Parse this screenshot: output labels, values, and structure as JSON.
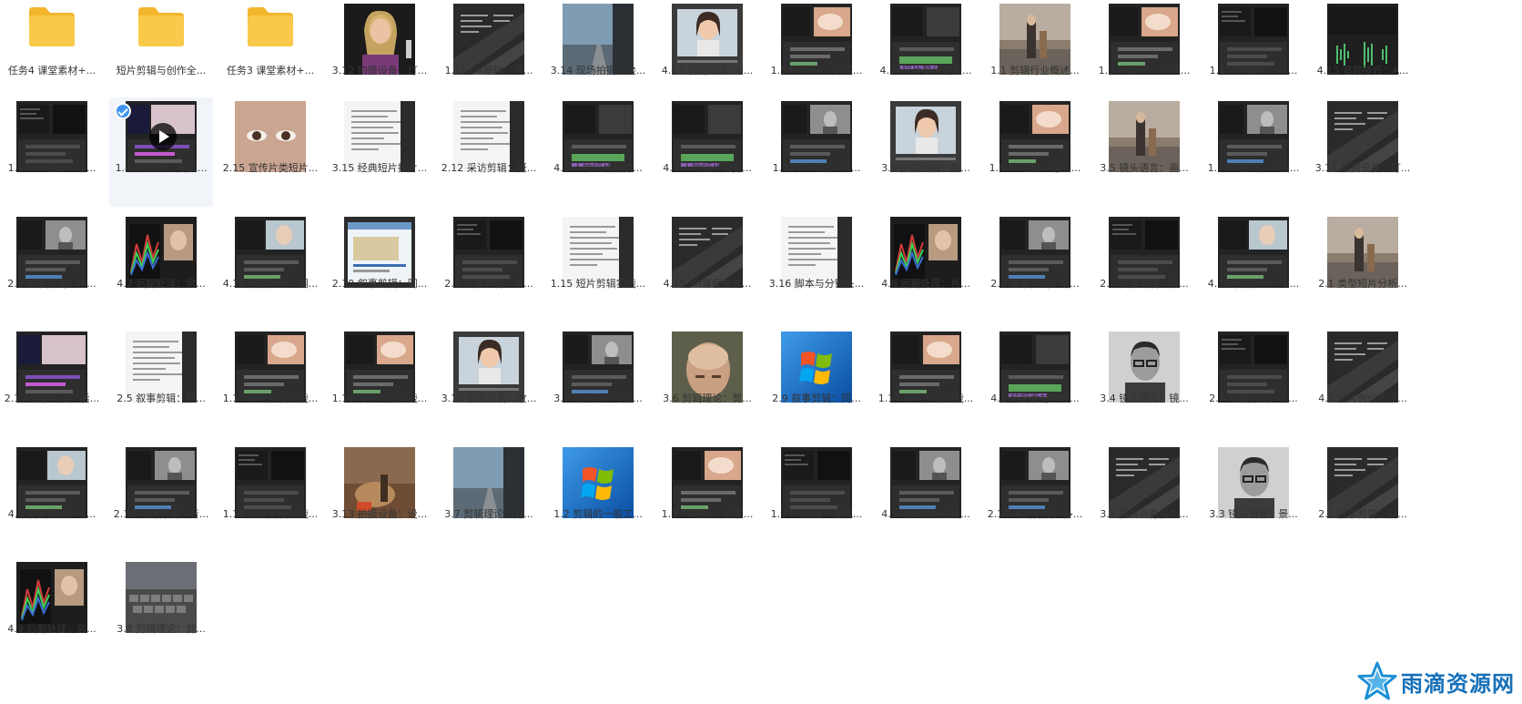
{
  "files": [
    {
      "label": "任务4 课堂素材+...",
      "kind": "folder"
    },
    {
      "label": "短片剪辑与创作全...",
      "kind": "folder"
    },
    {
      "label": "任务3 课堂素材+...",
      "kind": "folder"
    },
    {
      "label": "3.12 拍摄设备：灯...",
      "kind": "video",
      "style": "portrait"
    },
    {
      "label": "1.11 PR基础：常...",
      "kind": "video",
      "style": "dark-text"
    },
    {
      "label": "3.14 现场拍摄经验...",
      "kind": "video",
      "style": "road"
    },
    {
      "label": "4.11 后期处理：u...",
      "kind": "video",
      "style": "face-light"
    },
    {
      "label": "1.5 PR基础：剪辑...",
      "kind": "video",
      "style": "editor-warm"
    },
    {
      "label": "4.14短片整体调整...",
      "kind": "video",
      "style": "editor-green"
    },
    {
      "label": "1.1 剪辑行业概述...",
      "kind": "video",
      "style": "street"
    },
    {
      "label": "1.3 PR基础：新建...",
      "kind": "video",
      "style": "editor-warm"
    },
    {
      "label": "1.10 PR基础：遮...",
      "kind": "video",
      "style": "editor"
    },
    {
      "label": "4.13 音频技巧：A...",
      "kind": "video",
      "style": "audio"
    },
    {
      "label": "1.13 PR基础：输...",
      "kind": "video",
      "style": "editor"
    },
    {
      "label": "1.4 PR基础：窗口...",
      "kind": "video",
      "style": "editor-purple",
      "selected": true
    },
    {
      "label": "2.15 宣传片类短片...",
      "kind": "video",
      "style": "eye"
    },
    {
      "label": "3.15 经典短片拉片...",
      "kind": "video",
      "style": "doc"
    },
    {
      "label": "2.12 采访剪辑：概...",
      "kind": "video",
      "style": "doc"
    },
    {
      "label": "4.5 人物短片精剪...",
      "kind": "video",
      "style": "editor-green"
    },
    {
      "label": "4.4 人物短片粗剪...",
      "kind": "video",
      "style": "editor-green"
    },
    {
      "label": "1.12 PR基础：常...",
      "kind": "video",
      "style": "editor-gray"
    },
    {
      "label": "3.9 拍摄设备：拍...",
      "kind": "video",
      "style": "face-light"
    },
    {
      "label": "1.6 PR基础：标签...",
      "kind": "video",
      "style": "editor-warm"
    },
    {
      "label": "3.5 镜头语言：画...",
      "kind": "video",
      "style": "street"
    },
    {
      "label": "1.9 PR基础：动画...",
      "kind": "video",
      "style": "editor-gray"
    },
    {
      "label": "3.11 拍摄设备：灯...",
      "kind": "video",
      "style": "dark-text"
    },
    {
      "label": "2.3 叙事剪辑：读...",
      "kind": "video",
      "style": "editor-gray"
    },
    {
      "label": "4.7 后期处理：常...",
      "kind": "video",
      "style": "scopes"
    },
    {
      "label": "4.12 后期处理：调...",
      "kind": "video",
      "style": "editor-light"
    },
    {
      "label": "2.10 叙事剪辑：同...",
      "kind": "video",
      "style": "doc-blue"
    },
    {
      "label": "2.8 叙事剪辑：快...",
      "kind": "video",
      "style": "editor"
    },
    {
      "label": "1.15 短片剪辑实战...",
      "kind": "video",
      "style": "doc"
    },
    {
      "label": "4.15 PR课程整体...",
      "kind": "video",
      "style": "dark-text"
    },
    {
      "label": "3.16 脚本与分镜头...",
      "kind": "video",
      "style": "doc"
    },
    {
      "label": "4.6 后期处理：色...",
      "kind": "video",
      "style": "scopes"
    },
    {
      "label": "2.6 叙事剪辑：精...",
      "kind": "video",
      "style": "editor-gray"
    },
    {
      "label": "2.4 叙事剪辑：素...",
      "kind": "video",
      "style": "editor"
    },
    {
      "label": "4.10 后期处理：u...",
      "kind": "video",
      "style": "editor-light"
    },
    {
      "label": "2.1 类型短片分析...",
      "kind": "video",
      "style": "street"
    },
    {
      "label": "2.11 叙事剪辑：后...",
      "kind": "video",
      "style": "editor-purple"
    },
    {
      "label": "2.5 叙事剪辑：粗...",
      "kind": "video",
      "style": "doc"
    },
    {
      "label": "1.17 短片剪辑实战...",
      "kind": "video",
      "style": "editor-warm"
    },
    {
      "label": "1.16 短片剪辑实战...",
      "kind": "video",
      "style": "editor-warm"
    },
    {
      "label": "3.10 拍摄设备：收...",
      "kind": "video",
      "style": "face-light"
    },
    {
      "label": "3.2 短片分析与推...",
      "kind": "video",
      "style": "editor-gray"
    },
    {
      "label": "3.6 剪辑理论：剪...",
      "kind": "video",
      "style": "face-dark"
    },
    {
      "label": "2.9 叙事剪辑：同...",
      "kind": "video",
      "style": "windows"
    },
    {
      "label": "1.14 短片剪辑实战...",
      "kind": "video",
      "style": "editor-warm"
    },
    {
      "label": "4.2 前期素材整理...",
      "kind": "video",
      "style": "editor-green"
    },
    {
      "label": "3.4 镜头语言：镜...",
      "kind": "video",
      "style": "face-gray"
    },
    {
      "label": "2.7 叙事剪辑：同...",
      "kind": "video",
      "style": "editor"
    },
    {
      "label": "4.1 短片创作概述...",
      "kind": "video",
      "style": "dark-text"
    },
    {
      "label": "4.8 后期处理：lu...",
      "kind": "video",
      "style": "editor-light"
    },
    {
      "label": "2.13 采访剪辑：音...",
      "kind": "video",
      "style": "editor-gray"
    },
    {
      "label": "1.18 短片剪辑实战...",
      "kind": "video",
      "style": "editor"
    },
    {
      "label": "3.13 拍摄设备：设...",
      "kind": "video",
      "style": "warm-photo"
    },
    {
      "label": "3.7 剪辑理论：剪...",
      "kind": "video",
      "style": "road"
    },
    {
      "label": "1.2 剪辑的一般工...",
      "kind": "video",
      "style": "windows"
    },
    {
      "label": "1.8 PR基础：文字...",
      "kind": "video",
      "style": "editor-warm"
    },
    {
      "label": "1.7 PR基础：音视...",
      "kind": "video",
      "style": "editor"
    },
    {
      "label": "4.3 以人物为主线...",
      "kind": "video",
      "style": "editor-gray"
    },
    {
      "label": "2.14 采访剪辑：多...",
      "kind": "video",
      "style": "editor-gray"
    },
    {
      "label": "3.1 提高自身拍片...",
      "kind": "video",
      "style": "dark-text"
    },
    {
      "label": "3.3 镜头语言：景...",
      "kind": "video",
      "style": "face-gray"
    },
    {
      "label": "2.2 叙事剪辑：前...",
      "kind": "video",
      "style": "dark-text"
    },
    {
      "label": "4.9 后期处理：尝...",
      "kind": "video",
      "style": "scopes"
    },
    {
      "label": "3.8 剪辑理论：剪...",
      "kind": "video",
      "style": "keyboard"
    }
  ],
  "watermark": {
    "text": "雨滴资源网",
    "icon": "star-logo-icon",
    "color": "#1670b8"
  },
  "colors": {
    "folder": "#f8c94b",
    "folder_tab": "#f2b62e",
    "selected_bg": "#f1f5fa",
    "check": "#3d95f0"
  }
}
